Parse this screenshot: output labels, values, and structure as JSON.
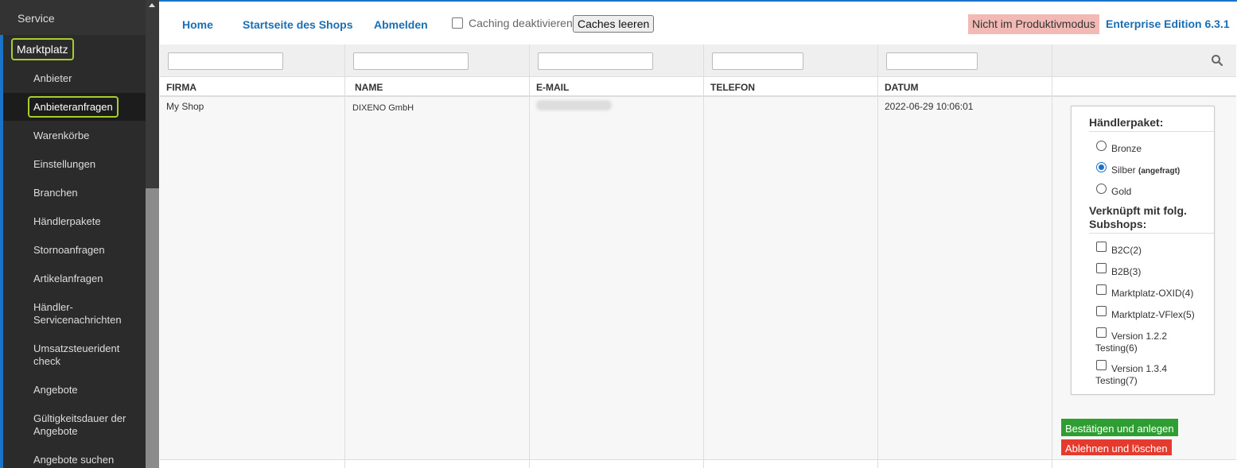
{
  "sidebar": {
    "service": "Service",
    "group": "Marktplatz",
    "items": [
      {
        "label": "Anbieter"
      },
      {
        "label": "Anbieteranfragen"
      },
      {
        "label": "Warenkörbe"
      },
      {
        "label": "Einstellungen"
      },
      {
        "label": "Branchen"
      },
      {
        "label": "Händlerpakete"
      },
      {
        "label": "Stornoanfragen"
      },
      {
        "label": "Artikelanfragen"
      },
      {
        "label": "Händler-Servicenachrichten"
      },
      {
        "label": "Umsatzsteuerident check"
      },
      {
        "label": "Angebote"
      },
      {
        "label": "Gültigkeitsdauer der Angebote"
      },
      {
        "label": "Angebote suchen"
      }
    ]
  },
  "topbar": {
    "home": "Home",
    "shop": "Startseite des Shops",
    "logout": "Abmelden",
    "caching_label": "Caching deaktivieren",
    "clear_caches": "Caches leeren",
    "mode_badge": "Nicht im Produktivmodus",
    "edition": "Enterprise Edition 6.3.1"
  },
  "table": {
    "headers": [
      "FIRMA",
      "NAME",
      "E-MAIL",
      "TELEFON",
      "DATUM"
    ],
    "row": {
      "firma": "My Shop",
      "name": "DIXENO GmbH",
      "telefon": "",
      "datum": "2022-06-29 10:06:01"
    }
  },
  "panel": {
    "package_title": "Händlerpaket:",
    "packages": [
      {
        "label": "Bronze",
        "note": "",
        "selected": false
      },
      {
        "label": "Silber",
        "note": "(angefragt)",
        "selected": true
      },
      {
        "label": "Gold",
        "note": "",
        "selected": false
      }
    ],
    "subshops_title": "Verknüpft mit folg. Subshops:",
    "subshops": [
      {
        "label": "B2C(2)",
        "checked": false
      },
      {
        "label": "B2B(3)",
        "checked": false
      },
      {
        "label": "Marktplatz-OXID(4)",
        "checked": false
      },
      {
        "label": "Marktplatz-VFlex(5)",
        "checked": false
      },
      {
        "label": "Version 1.2.2 Testing(6)",
        "checked": false
      },
      {
        "label": "Version 1.3.4 Testing(7)",
        "checked": false
      }
    ]
  },
  "actions": {
    "confirm": "Bestätigen und anlegen",
    "reject": "Ablehnen und löschen"
  },
  "colors": {
    "accent": "#1a73c8",
    "sidebar_bg": "#2b2b2b",
    "highlight": "#a6cc2e",
    "confirm": "#2e9e33",
    "reject": "#e53b2e",
    "badge": "#f3b9b5"
  }
}
